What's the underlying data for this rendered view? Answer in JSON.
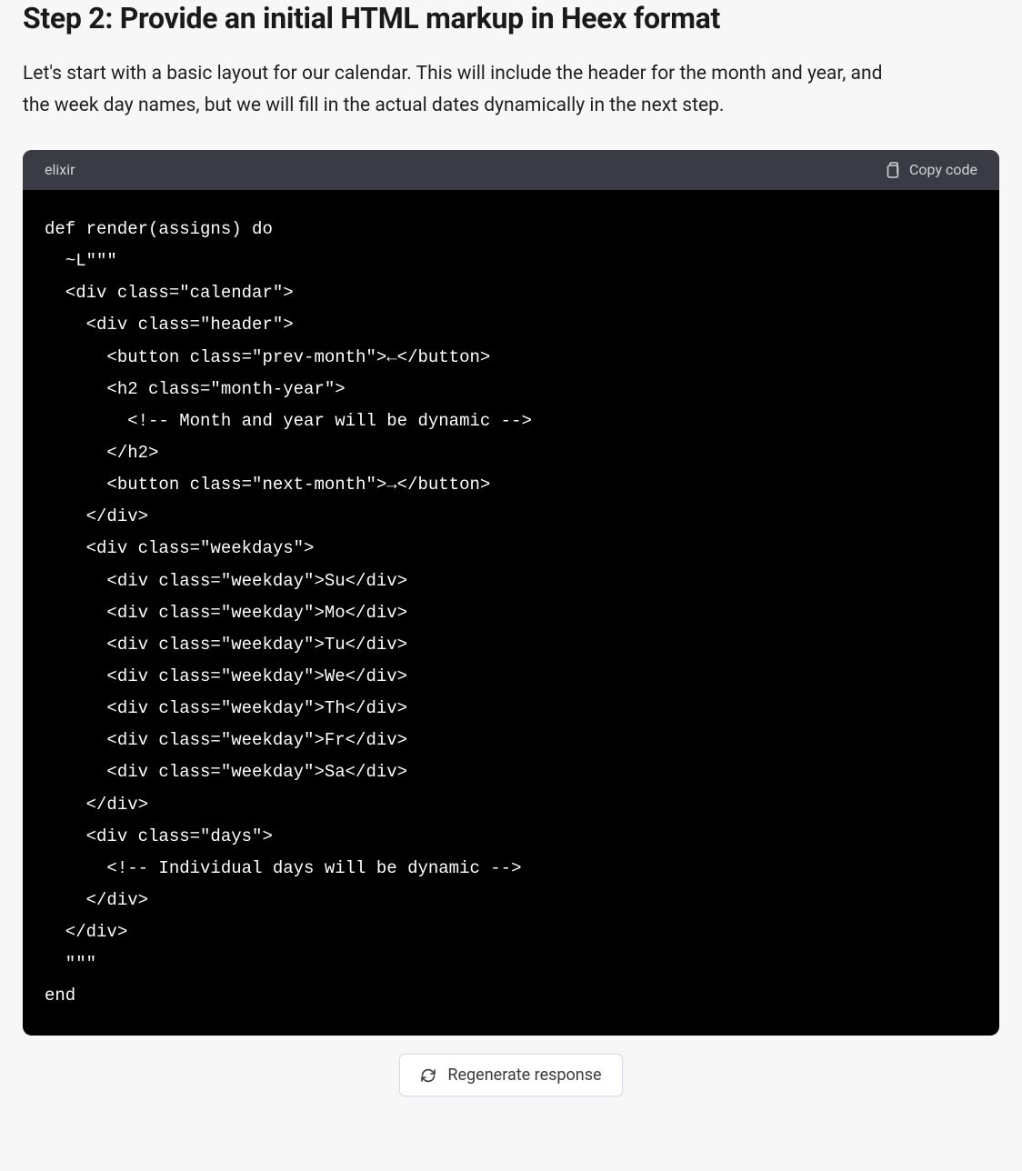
{
  "heading": "Step 2: Provide an initial HTML markup in Heex format",
  "intro": "Let's start with a basic layout for our calendar. This will include the header for the month and year, and the week day names, but we will fill in the actual dates dynamically in the next step.",
  "code_block": {
    "language": "elixir",
    "copy_label": "Copy code",
    "content": "def render(assigns) do\n  ~L\"\"\"\n  <div class=\"calendar\">\n    <div class=\"header\">\n      <button class=\"prev-month\">←</button>\n      <h2 class=\"month-year\">\n        <!-- Month and year will be dynamic -->\n      </h2>\n      <button class=\"next-month\">→</button>\n    </div>\n    <div class=\"weekdays\">\n      <div class=\"weekday\">Su</div>\n      <div class=\"weekday\">Mo</div>\n      <div class=\"weekday\">Tu</div>\n      <div class=\"weekday\">We</div>\n      <div class=\"weekday\">Th</div>\n      <div class=\"weekday\">Fr</div>\n      <div class=\"weekday\">Sa</div>\n    </div>\n    <div class=\"days\">\n      <!-- Individual days will be dynamic -->\n    </div>\n  </div>\n  \"\"\"\nend"
  },
  "regenerate_label": "Regenerate response"
}
